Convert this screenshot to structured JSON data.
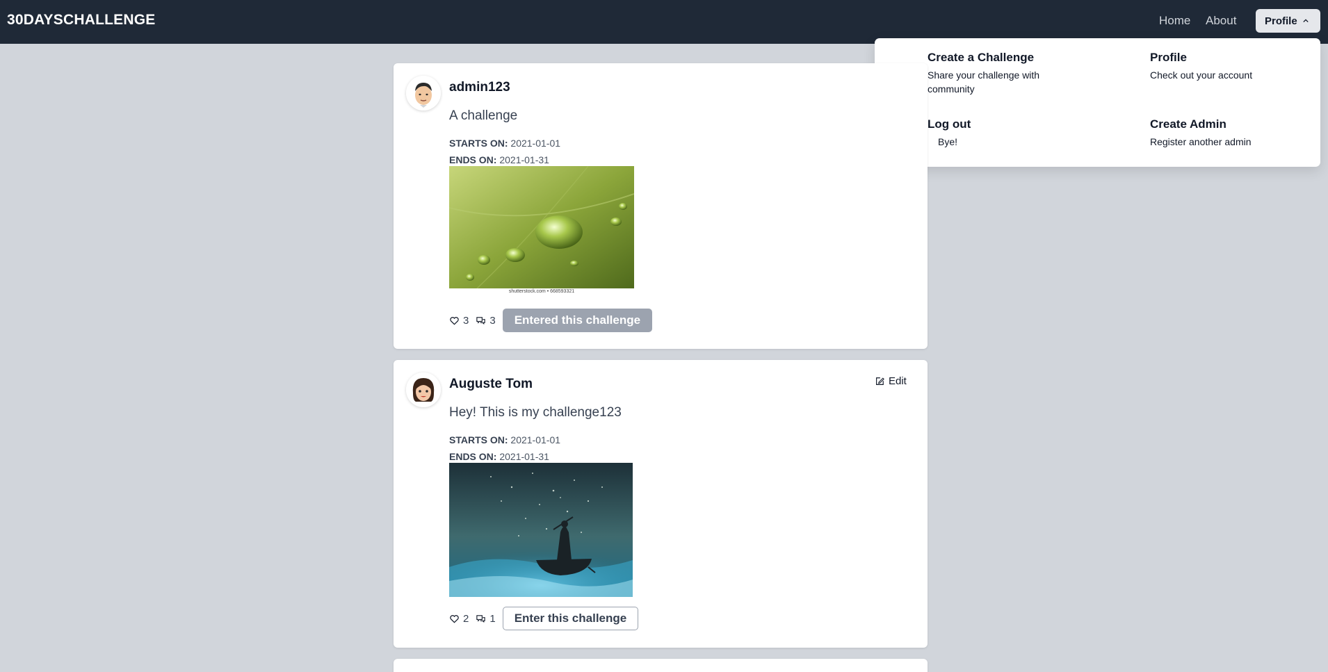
{
  "navbar": {
    "brand": "30DAYSCHALLENGE",
    "home": "Home",
    "about": "About",
    "profile_button": "Profile"
  },
  "dropdown": {
    "items": [
      {
        "title": "Create a Challenge",
        "desc": "Share your challenge with community"
      },
      {
        "title": "Profile",
        "desc": "Check out your account"
      },
      {
        "title": "Log out",
        "desc": "Bye!"
      },
      {
        "title": "Create Admin",
        "desc": "Register another admin"
      }
    ]
  },
  "posts": [
    {
      "author": "admin123",
      "title": "A challenge",
      "starts_label": "STARTS ON:",
      "starts": "2021-01-01",
      "ends_label": "ENDS ON:",
      "ends": "2021-01-31",
      "image_caption": "shutterstock.com • 668593321",
      "likes": "3",
      "comments": "3",
      "action_label": "Entered this challenge"
    },
    {
      "author": "Auguste Tom",
      "title": "Hey! This is my challenge123",
      "starts_label": "STARTS ON:",
      "starts": "2021-01-01",
      "ends_label": "ENDS ON:",
      "ends": "2021-01-31",
      "likes": "2",
      "comments": "1",
      "action_label": "Enter this challenge",
      "edit_label": "Edit"
    }
  ],
  "colors": {
    "navbar_bg": "#1f2937",
    "page_bg": "#d1d5db",
    "entered_button_bg": "#9ca3af"
  }
}
